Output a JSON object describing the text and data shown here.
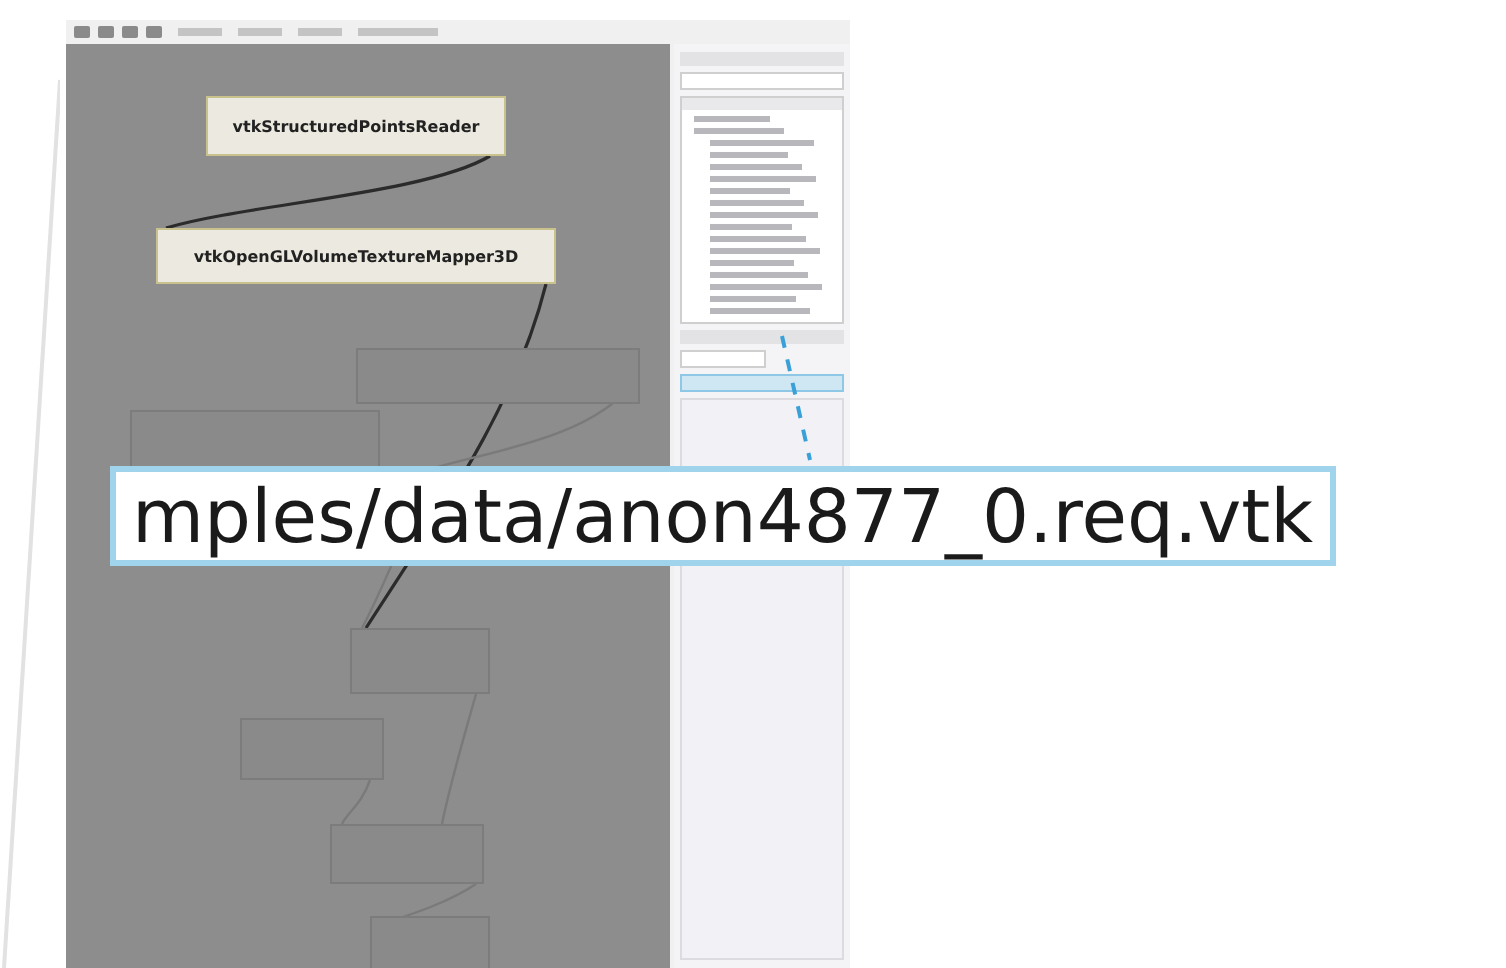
{
  "modules": [
    {
      "kind": "active",
      "label": "vtkStructuredPointsReader"
    },
    {
      "kind": "active",
      "label": "vtkOpenGLVolumeTextureMapper3D"
    },
    {
      "kind": "faded"
    },
    {
      "kind": "faded"
    },
    {
      "kind": "faded"
    },
    {
      "kind": "faded"
    },
    {
      "kind": "faded"
    },
    {
      "kind": "faded"
    }
  ],
  "callout": {
    "value": "mples/data/anon4877_0.req.vtk"
  }
}
